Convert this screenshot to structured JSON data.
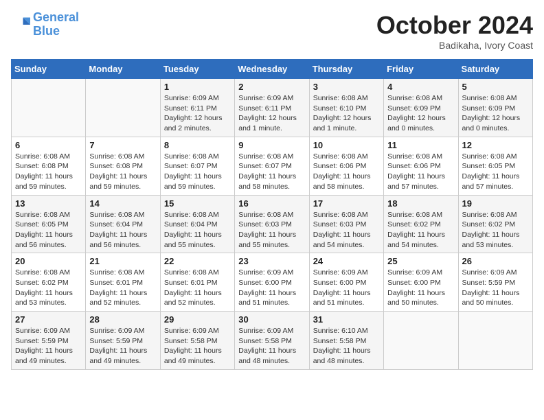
{
  "header": {
    "logo_general": "General",
    "logo_blue": "Blue",
    "month": "October 2024",
    "location": "Badikaha, Ivory Coast"
  },
  "weekdays": [
    "Sunday",
    "Monday",
    "Tuesday",
    "Wednesday",
    "Thursday",
    "Friday",
    "Saturday"
  ],
  "weeks": [
    [
      {
        "day": "",
        "detail": ""
      },
      {
        "day": "",
        "detail": ""
      },
      {
        "day": "1",
        "detail": "Sunrise: 6:09 AM\nSunset: 6:11 PM\nDaylight: 12 hours\nand 2 minutes."
      },
      {
        "day": "2",
        "detail": "Sunrise: 6:09 AM\nSunset: 6:11 PM\nDaylight: 12 hours\nand 1 minute."
      },
      {
        "day": "3",
        "detail": "Sunrise: 6:08 AM\nSunset: 6:10 PM\nDaylight: 12 hours\nand 1 minute."
      },
      {
        "day": "4",
        "detail": "Sunrise: 6:08 AM\nSunset: 6:09 PM\nDaylight: 12 hours\nand 0 minutes."
      },
      {
        "day": "5",
        "detail": "Sunrise: 6:08 AM\nSunset: 6:09 PM\nDaylight: 12 hours\nand 0 minutes."
      }
    ],
    [
      {
        "day": "6",
        "detail": "Sunrise: 6:08 AM\nSunset: 6:08 PM\nDaylight: 11 hours\nand 59 minutes."
      },
      {
        "day": "7",
        "detail": "Sunrise: 6:08 AM\nSunset: 6:08 PM\nDaylight: 11 hours\nand 59 minutes."
      },
      {
        "day": "8",
        "detail": "Sunrise: 6:08 AM\nSunset: 6:07 PM\nDaylight: 11 hours\nand 59 minutes."
      },
      {
        "day": "9",
        "detail": "Sunrise: 6:08 AM\nSunset: 6:07 PM\nDaylight: 11 hours\nand 58 minutes."
      },
      {
        "day": "10",
        "detail": "Sunrise: 6:08 AM\nSunset: 6:06 PM\nDaylight: 11 hours\nand 58 minutes."
      },
      {
        "day": "11",
        "detail": "Sunrise: 6:08 AM\nSunset: 6:06 PM\nDaylight: 11 hours\nand 57 minutes."
      },
      {
        "day": "12",
        "detail": "Sunrise: 6:08 AM\nSunset: 6:05 PM\nDaylight: 11 hours\nand 57 minutes."
      }
    ],
    [
      {
        "day": "13",
        "detail": "Sunrise: 6:08 AM\nSunset: 6:05 PM\nDaylight: 11 hours\nand 56 minutes."
      },
      {
        "day": "14",
        "detail": "Sunrise: 6:08 AM\nSunset: 6:04 PM\nDaylight: 11 hours\nand 56 minutes."
      },
      {
        "day": "15",
        "detail": "Sunrise: 6:08 AM\nSunset: 6:04 PM\nDaylight: 11 hours\nand 55 minutes."
      },
      {
        "day": "16",
        "detail": "Sunrise: 6:08 AM\nSunset: 6:03 PM\nDaylight: 11 hours\nand 55 minutes."
      },
      {
        "day": "17",
        "detail": "Sunrise: 6:08 AM\nSunset: 6:03 PM\nDaylight: 11 hours\nand 54 minutes."
      },
      {
        "day": "18",
        "detail": "Sunrise: 6:08 AM\nSunset: 6:02 PM\nDaylight: 11 hours\nand 54 minutes."
      },
      {
        "day": "19",
        "detail": "Sunrise: 6:08 AM\nSunset: 6:02 PM\nDaylight: 11 hours\nand 53 minutes."
      }
    ],
    [
      {
        "day": "20",
        "detail": "Sunrise: 6:08 AM\nSunset: 6:02 PM\nDaylight: 11 hours\nand 53 minutes."
      },
      {
        "day": "21",
        "detail": "Sunrise: 6:08 AM\nSunset: 6:01 PM\nDaylight: 11 hours\nand 52 minutes."
      },
      {
        "day": "22",
        "detail": "Sunrise: 6:08 AM\nSunset: 6:01 PM\nDaylight: 11 hours\nand 52 minutes."
      },
      {
        "day": "23",
        "detail": "Sunrise: 6:09 AM\nSunset: 6:00 PM\nDaylight: 11 hours\nand 51 minutes."
      },
      {
        "day": "24",
        "detail": "Sunrise: 6:09 AM\nSunset: 6:00 PM\nDaylight: 11 hours\nand 51 minutes."
      },
      {
        "day": "25",
        "detail": "Sunrise: 6:09 AM\nSunset: 6:00 PM\nDaylight: 11 hours\nand 50 minutes."
      },
      {
        "day": "26",
        "detail": "Sunrise: 6:09 AM\nSunset: 5:59 PM\nDaylight: 11 hours\nand 50 minutes."
      }
    ],
    [
      {
        "day": "27",
        "detail": "Sunrise: 6:09 AM\nSunset: 5:59 PM\nDaylight: 11 hours\nand 49 minutes."
      },
      {
        "day": "28",
        "detail": "Sunrise: 6:09 AM\nSunset: 5:59 PM\nDaylight: 11 hours\nand 49 minutes."
      },
      {
        "day": "29",
        "detail": "Sunrise: 6:09 AM\nSunset: 5:58 PM\nDaylight: 11 hours\nand 49 minutes."
      },
      {
        "day": "30",
        "detail": "Sunrise: 6:09 AM\nSunset: 5:58 PM\nDaylight: 11 hours\nand 48 minutes."
      },
      {
        "day": "31",
        "detail": "Sunrise: 6:10 AM\nSunset: 5:58 PM\nDaylight: 11 hours\nand 48 minutes."
      },
      {
        "day": "",
        "detail": ""
      },
      {
        "day": "",
        "detail": ""
      }
    ]
  ]
}
